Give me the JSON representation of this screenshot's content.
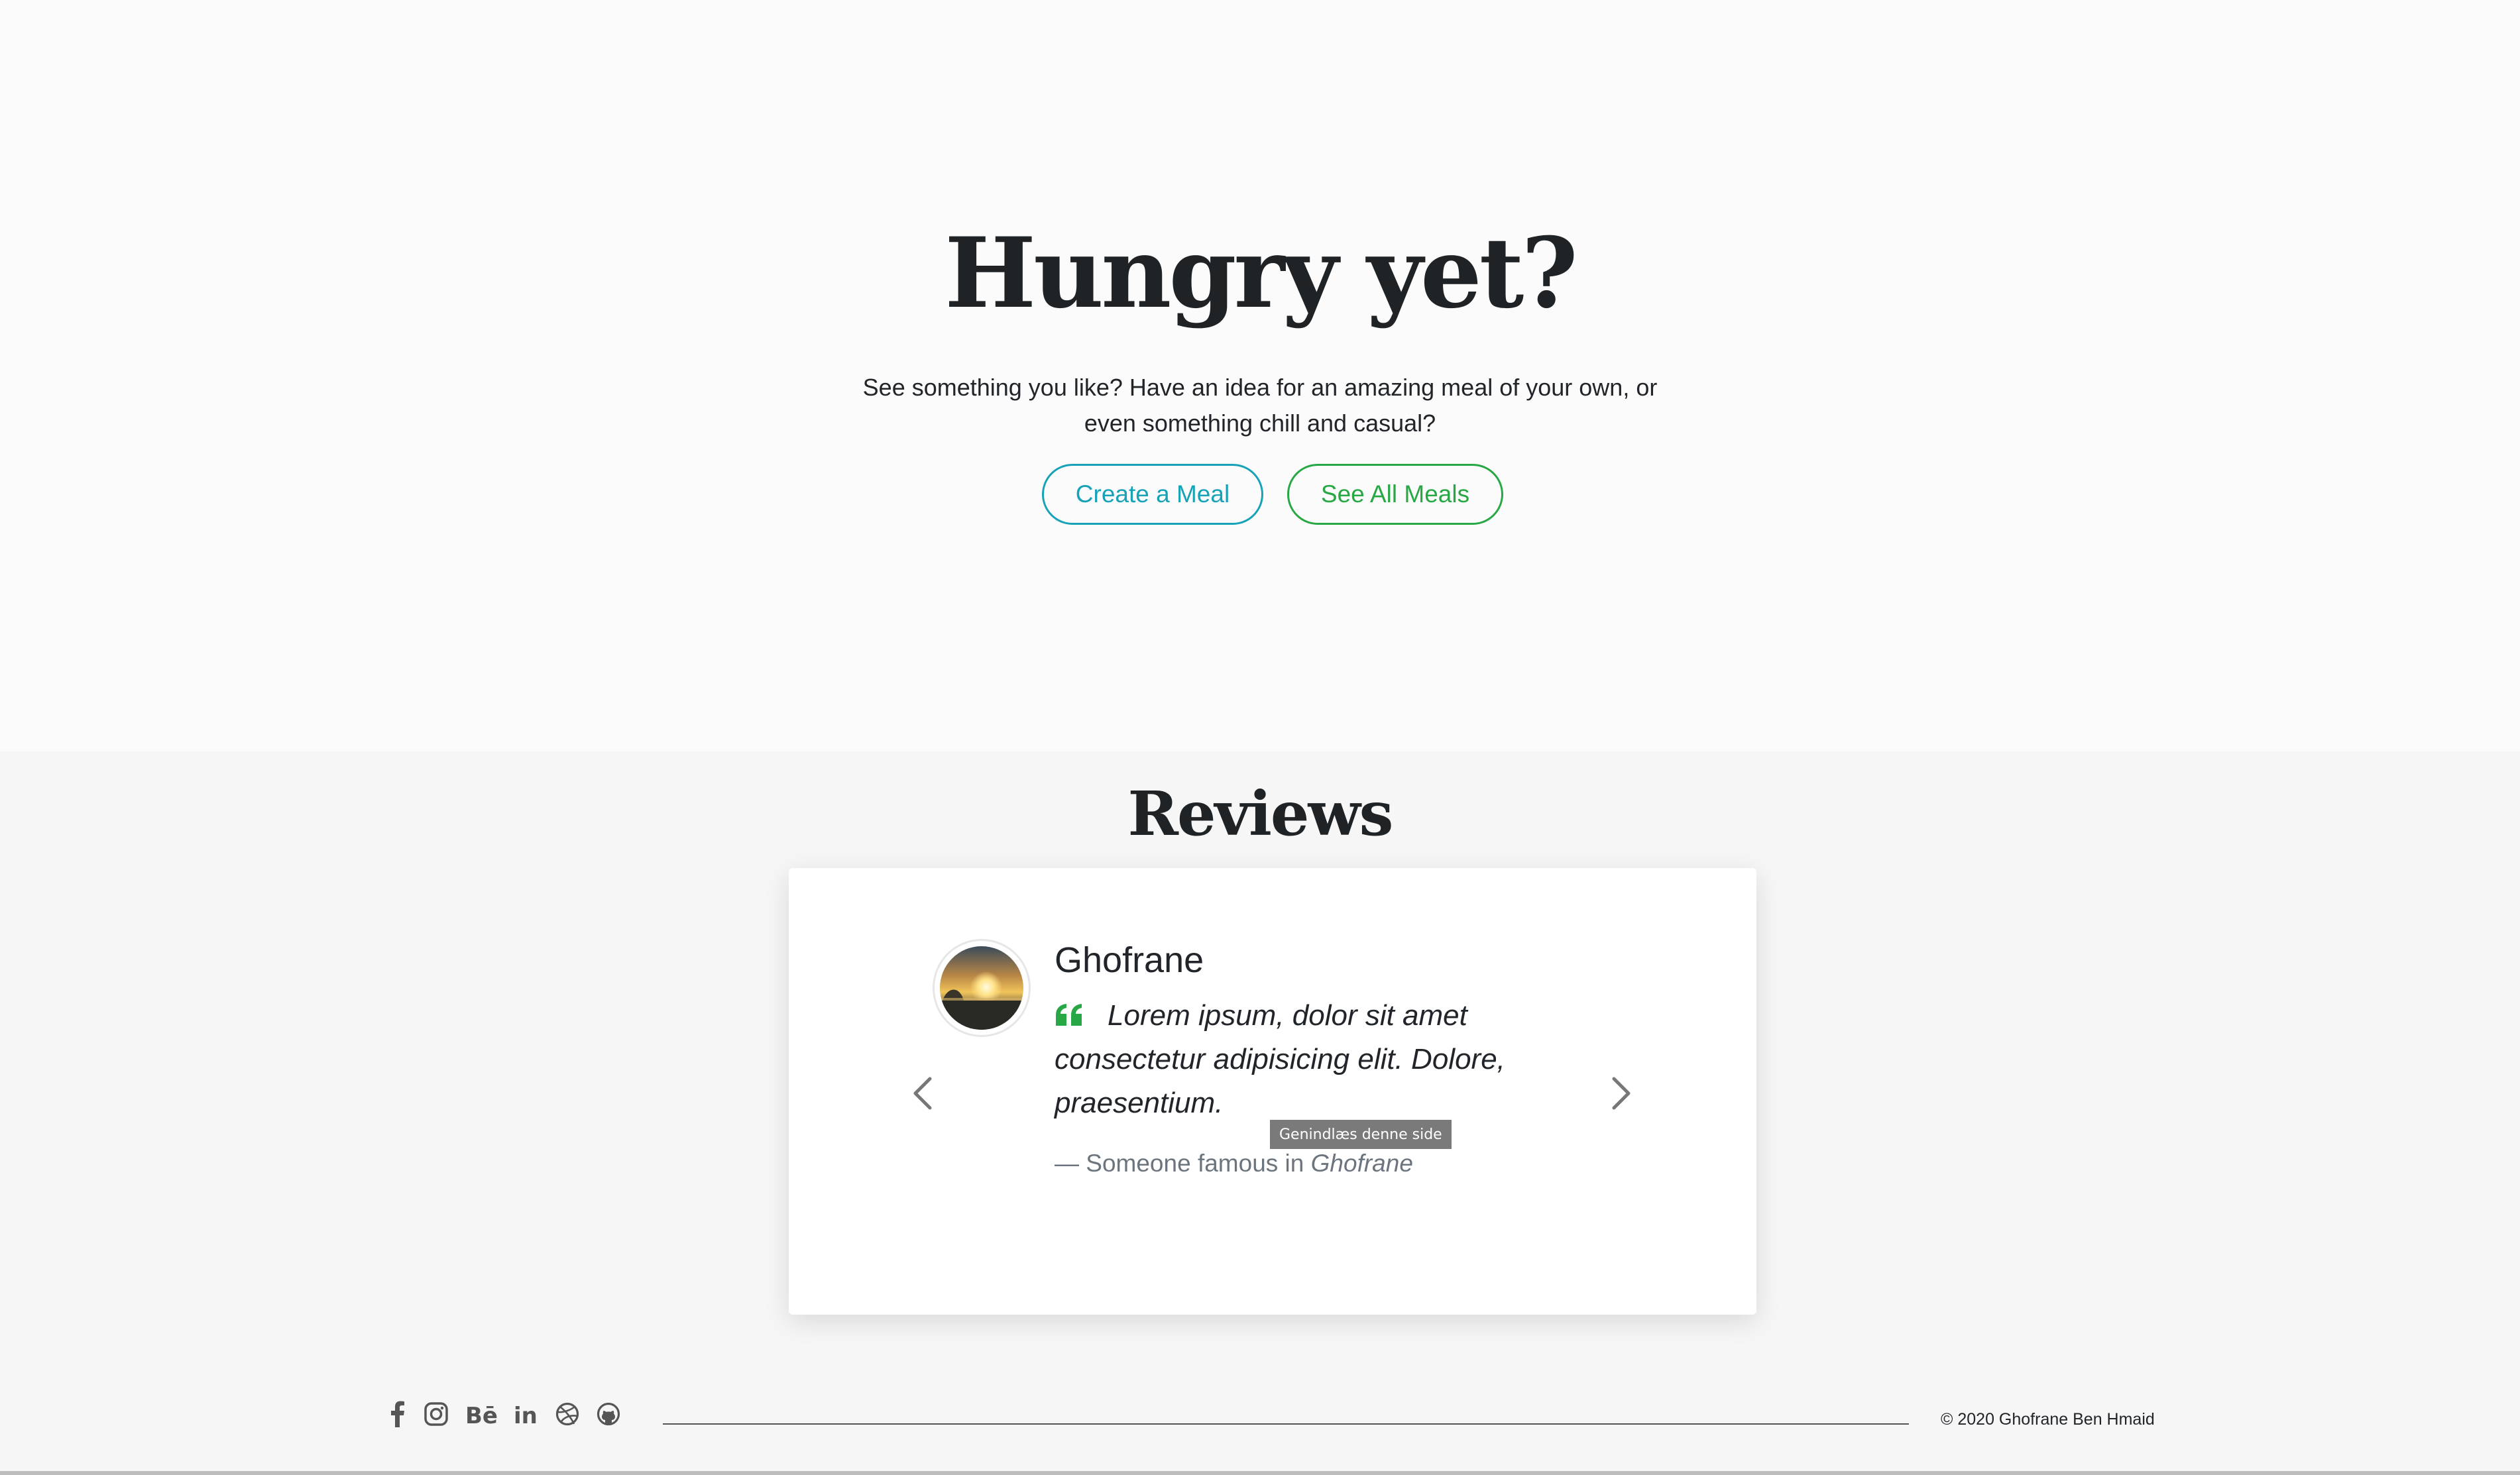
{
  "hero": {
    "title": "Hungry yet?",
    "subtitle_line1": "See something you like? Have an idea for an amazing meal of your own, or",
    "subtitle_line2": "even something chill and casual?",
    "create_button": "Create a Meal",
    "see_all_button": "See All Meals"
  },
  "reviews": {
    "title": "Reviews",
    "review": {
      "name": "Ghofrane",
      "quote": "Lorem ipsum, dolor sit amet consectetur adipisicing elit. Dolore, praesentium.",
      "attribution_prefix": "— Someone famous in ",
      "attribution_source": "Ghofrane"
    },
    "tooltip": "Genindlæs denne side"
  },
  "footer": {
    "social_icons": [
      "facebook-icon",
      "instagram-icon",
      "behance-icon",
      "linkedin-icon",
      "dribbble-icon",
      "github-icon"
    ],
    "copyright": "© 2020 Ghofrane Ben Hmaid"
  },
  "colors": {
    "info": "#17a2b8",
    "success": "#28a745",
    "muted": "#6c757d"
  }
}
